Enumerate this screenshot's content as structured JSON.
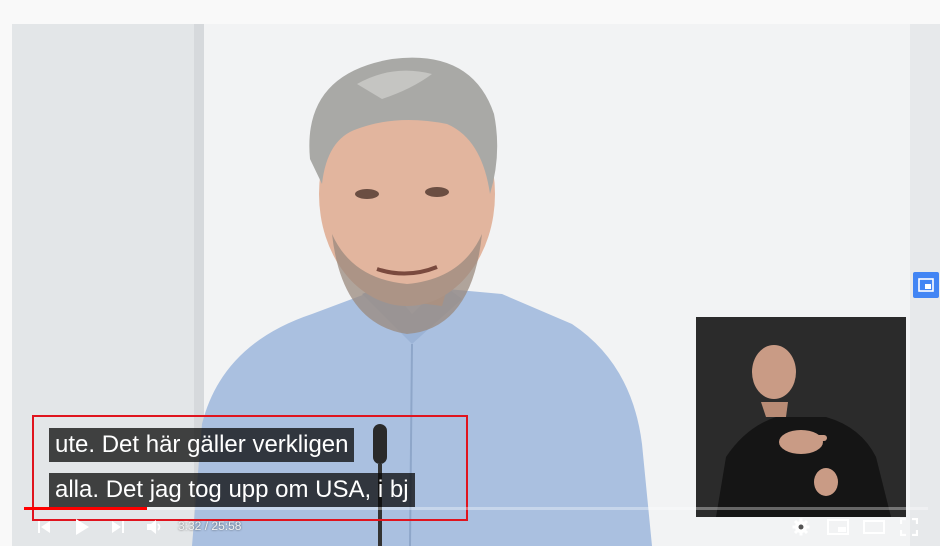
{
  "player": {
    "captions": {
      "line1": "ute. Det här gäller verkligen",
      "line2": "alla. Det jag tog upp om USA, i bj"
    },
    "time": {
      "current": "3:32",
      "separator": "/",
      "duration": "25:58"
    },
    "progress": 0.136,
    "controls": {
      "previous_icon": "skip-previous-icon",
      "play_icon": "play-icon",
      "next_icon": "skip-next-icon",
      "volume_icon": "volume-icon",
      "settings_icon": "gear-icon",
      "miniplayer_icon": "miniplayer-icon",
      "theater_icon": "theater-mode-icon",
      "fullscreen_icon": "fullscreen-icon"
    },
    "side_button_icon": "screenshot-icon",
    "colors": {
      "progress": "#ff0000",
      "caption_outline": "#e0141e",
      "side_button": "#4285f4"
    }
  }
}
